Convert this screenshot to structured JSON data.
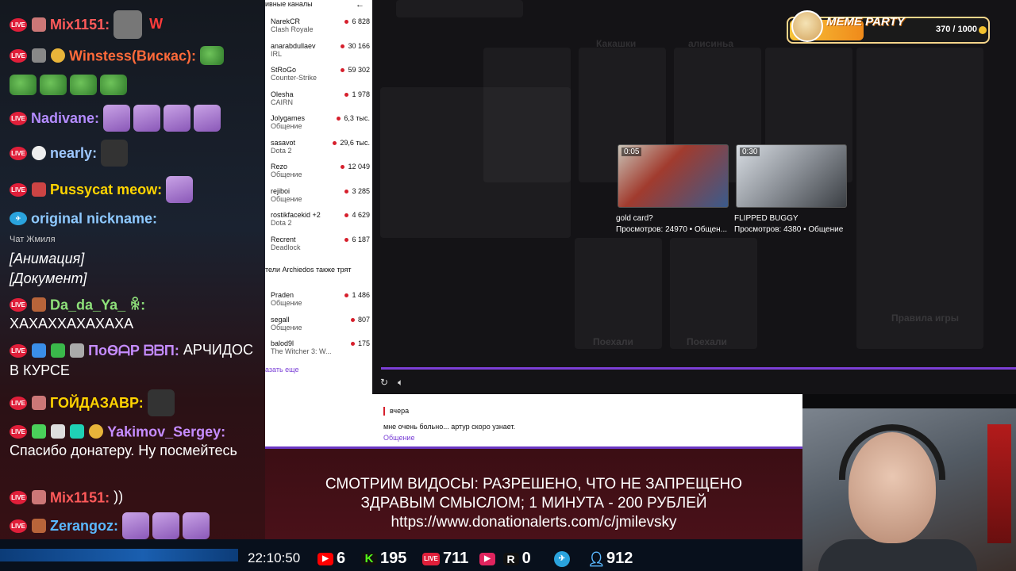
{
  "chat": [
    {
      "nick": "Mix1151:",
      "color": "#ff5a5a",
      "text": "W",
      "text_color": "#ff3b3b"
    },
    {
      "nick": "Winstess(Вискас):",
      "color": "#ff6a3a"
    },
    {
      "nick": "Nadivane:",
      "color": "#b48cff"
    },
    {
      "nick": "nearly:",
      "color": "#9ec7ff"
    },
    {
      "nick": "Pussycat meow:",
      "color": "#ffd400"
    },
    {
      "nick": "original nickname:",
      "color": "#8ec9ff",
      "sub": "Чат Жмиля",
      "lines": [
        "[Анимация]",
        "[Документ]"
      ]
    },
    {
      "nick": "Da_da_Ya_ ꆜ:",
      "color": "#8ee07a",
      "text": "ХАХАХХАХАХАХА"
    },
    {
      "nick": "ПоѲᗩР ᗷᗷП:",
      "color": "#c58cff",
      "text": "АРЧИДОС В КУРСЕ"
    },
    {
      "nick": "ГОЙДАЗАВР:",
      "color": "#ffd400"
    },
    {
      "nick": "Yakimov_Sergey:",
      "color": "#c58cff",
      "text": "Спасибо донатеру. Ну посмейтесь"
    },
    {
      "nick": "Mix1151:",
      "color": "#ff5a5a",
      "text": "))"
    },
    {
      "nick": "Zerangoz:",
      "color": "#5ab8ff"
    }
  ],
  "sidebar": {
    "header": "ивные каналы",
    "collapse_icon": "←",
    "channels": [
      {
        "name": "NarekCR",
        "game": "Clash Royale",
        "viewers": "6 828"
      },
      {
        "name": "anarabdullaev",
        "game": "IRL",
        "viewers": "30 166"
      },
      {
        "name": "StRoGo",
        "game": "Counter-Strike",
        "viewers": "59 302"
      },
      {
        "name": "Olesha",
        "game": "CAIRN",
        "viewers": "1 978"
      },
      {
        "name": "Jolygames",
        "game": "Общение",
        "viewers": "6,3 тыс."
      },
      {
        "name": "sasavot",
        "game": "Dota 2",
        "viewers": "29,6 тыс."
      },
      {
        "name": "Rezo",
        "game": "Общение",
        "viewers": "12 049"
      },
      {
        "name": "rejiboi",
        "game": "Общение",
        "viewers": "3 285"
      },
      {
        "name": "rostikfacekid +2",
        "game": "Dota 2",
        "viewers": "4 629"
      },
      {
        "name": "Recrent",
        "game": "Deadlock",
        "viewers": "6 187"
      }
    ],
    "section_title": "тели Archiedos также трят",
    "also_channels": [
      {
        "name": "Praden",
        "game": "Общение",
        "viewers": "1 486"
      },
      {
        "name": "segall",
        "game": "Общение",
        "viewers": "807"
      },
      {
        "name": "balod9l",
        "game": "The Witcher 3: W...",
        "viewers": "175"
      }
    ],
    "show_more": "азать еще"
  },
  "video": {
    "clips": [
      {
        "duration": "0:05",
        "title": "gold card?",
        "meta": "Просмотров: 24970 • Общен..."
      },
      {
        "duration": "0:30",
        "title": "FLIPPED BUGGY",
        "meta": "Просмотров: 4380 • Общение"
      }
    ],
    "bg_labels": [
      "Какашки",
      "алисиньа",
      "Поехали",
      "Поехали",
      "Правила игры"
    ]
  },
  "meme_party": {
    "title": "MEME PARTY",
    "progress": "370 / 1000",
    "progress_fraction": 0.37
  },
  "comment": {
    "date": "вчера",
    "text": "мне очень больно... артур скоро узнает.",
    "category": "Общение"
  },
  "banner": {
    "line1": "СМОТРИМ ВИДОСЫ: РАЗРЕШЕНО, ЧТО НЕ ЗАПРЕЩЕНО",
    "line2": "ЗДРАВЫМ СМЫСЛОМ; 1 МИНУТА - 200 РУБЛЕЙ",
    "line3": "https://www.donationalerts.com/c/jmilevsky"
  },
  "stats": {
    "clock": "22:10:50",
    "youtube": "6",
    "kick": "195",
    "vk_live": "711",
    "rutube": "0",
    "telegram": "",
    "viewers": "912"
  }
}
